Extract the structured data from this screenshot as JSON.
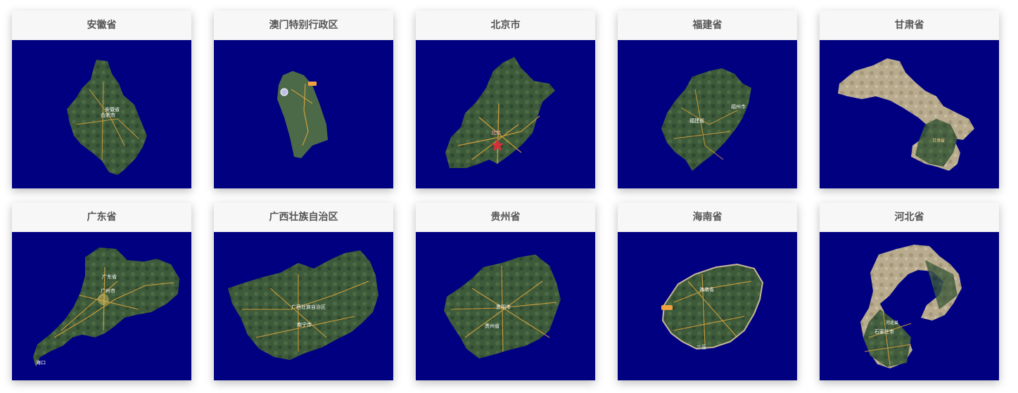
{
  "colors": {
    "card_header_bg": "#f7f7f7",
    "map_background": "#000080",
    "title_text": "#555555",
    "terrain_green": "#3d5a3a",
    "terrain_desert": "#b9ab8e",
    "road": "#e8a93c"
  },
  "cards": [
    {
      "title": "安徽省",
      "map": {
        "icon": "satellite-map",
        "labels": [
          "安徽省",
          "合肥市"
        ]
      }
    },
    {
      "title": "澳门特别行政区",
      "map": {
        "icon": "satellite-map",
        "labels": []
      }
    },
    {
      "title": "北京市",
      "map": {
        "icon": "satellite-map",
        "labels": [
          "北京"
        ]
      }
    },
    {
      "title": "福建省",
      "map": {
        "icon": "satellite-map",
        "labels": [
          "福州市",
          "福建省"
        ]
      }
    },
    {
      "title": "甘肃省",
      "map": {
        "icon": "satellite-map",
        "labels": [
          "甘肃省"
        ]
      }
    },
    {
      "title": "广东省",
      "map": {
        "icon": "satellite-map",
        "labels": [
          "广东省",
          "广州市",
          "海口"
        ]
      }
    },
    {
      "title": "广西壮族自治区",
      "map": {
        "icon": "satellite-map",
        "labels": [
          "广西壮族自治区",
          "南宁市"
        ]
      }
    },
    {
      "title": "贵州省",
      "map": {
        "icon": "satellite-map",
        "labels": [
          "贵阳市",
          "贵州省"
        ]
      }
    },
    {
      "title": "海南省",
      "map": {
        "icon": "satellite-map",
        "labels": [
          "海南省",
          "三亚"
        ]
      }
    },
    {
      "title": "河北省",
      "map": {
        "icon": "satellite-map",
        "labels": [
          "河北省",
          "石家庄市"
        ]
      }
    }
  ]
}
